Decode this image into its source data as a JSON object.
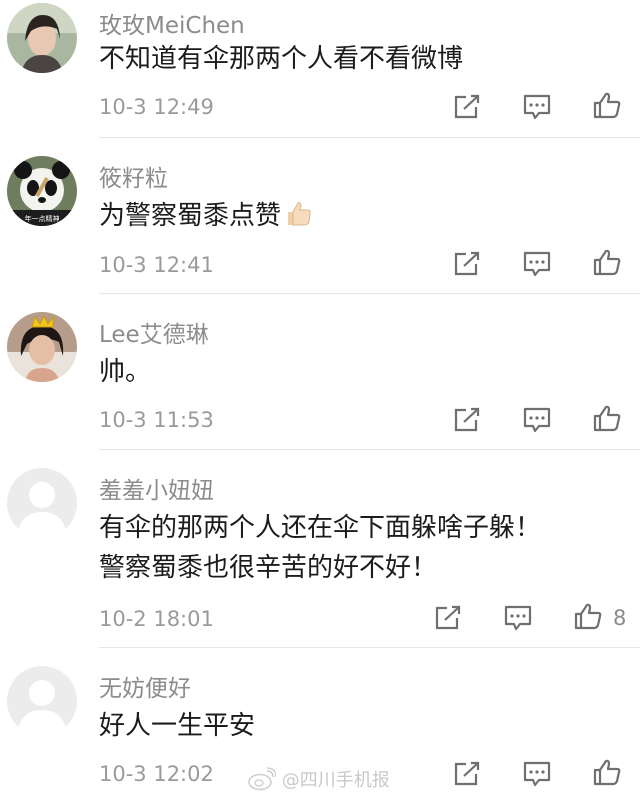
{
  "comments": [
    {
      "username": "玫玫MeiChen",
      "content": "不知道有伞那两个人看不看微博",
      "time": "10-3 12:49",
      "likes": ""
    },
    {
      "username": "筱籽粒",
      "content": "为警察蜀黍点赞",
      "time": "10-3 12:41",
      "likes": ""
    },
    {
      "username": "Lee艾德琳",
      "content": "帅。",
      "time": "10-3 11:53",
      "likes": ""
    },
    {
      "username": "羞羞小妞妞",
      "content": "有伞的那两个人还在伞下面躲啥子躲！\n警察蜀黍也很辛苦的好不好！",
      "time": "10-2 18:01",
      "likes": "8"
    },
    {
      "username": "无妨便好",
      "content": "好人一生平安",
      "time": "10-3 12:02",
      "likes": ""
    }
  ],
  "avatar_labels": {
    "panda": "年一点精神"
  },
  "emoji": {
    "thumbs_up": "thumbs-up-emoji"
  },
  "icons": {
    "share": "share-icon",
    "comment": "comment-icon",
    "like": "like-icon"
  },
  "watermark": {
    "text": "@四川手机报"
  },
  "colors": {
    "username": "#8c8c8c",
    "content": "#1c1c1c",
    "time": "#9a9a9a",
    "icon": "#6f6f6f",
    "divider": "#e6e6e6"
  }
}
